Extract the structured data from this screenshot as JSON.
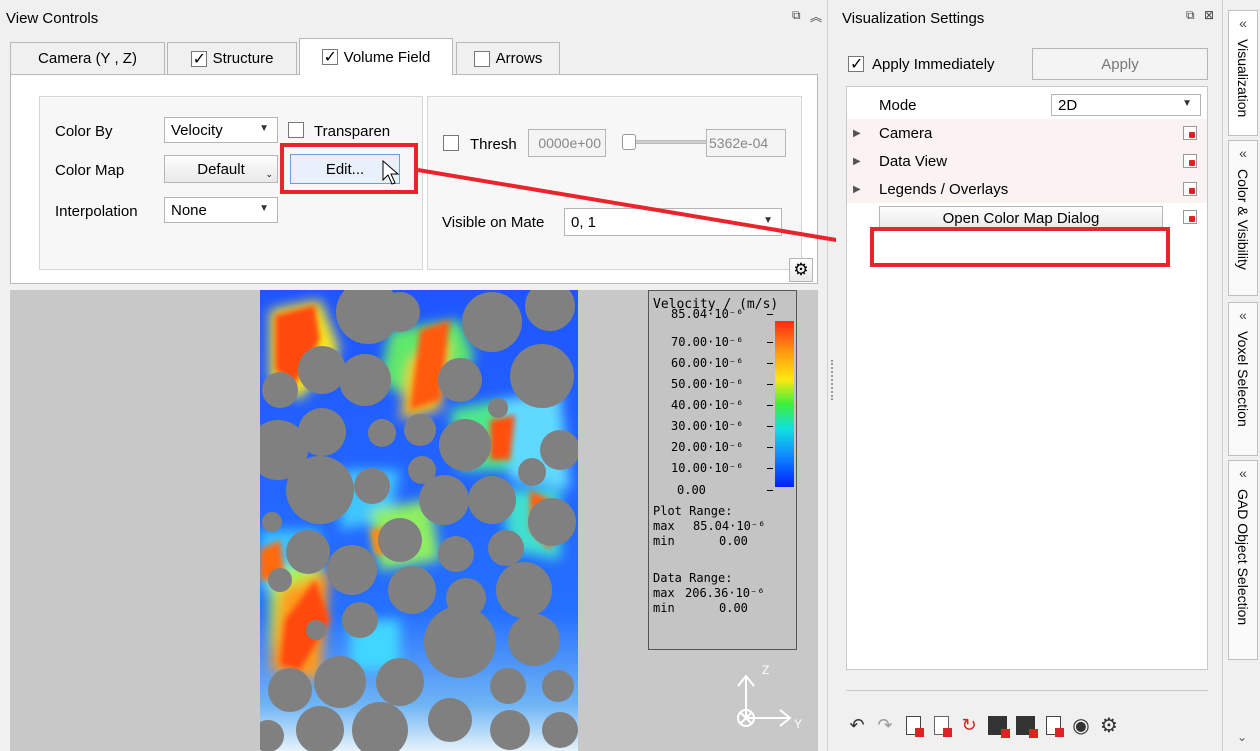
{
  "view_controls": {
    "title": "View Controls",
    "tabs": [
      {
        "label": "Camera (Y , Z)",
        "checkbox": null
      },
      {
        "label": "Structure",
        "checkbox": true
      },
      {
        "label": "Volume Field",
        "checkbox": true
      },
      {
        "label": "Arrows",
        "checkbox": false
      }
    ],
    "color_by": {
      "label": "Color By",
      "value": "Velocity"
    },
    "transparent": {
      "label": "Transparen",
      "checked": false
    },
    "color_map": {
      "label": "Color Map",
      "value": "Default",
      "edit_label": "Edit..."
    },
    "interpolation": {
      "label": "Interpolation",
      "value": "None"
    },
    "thresh": {
      "label": "Thresh",
      "checked": false,
      "min_value": "0000e+00",
      "max_value": "5362e-04"
    },
    "visible_on": {
      "label": "Visible on Mate",
      "value": "0, 1"
    }
  },
  "legend": {
    "title": "Velocity / (m/s)",
    "ticks": [
      "85.04·10⁻⁶",
      "70.00·10⁻⁶",
      "60.00·10⁻⁶",
      "50.00·10⁻⁶",
      "40.00·10⁻⁶",
      "30.00·10⁻⁶",
      "20.00·10⁻⁶",
      "10.00·10⁻⁶",
      "0.00"
    ],
    "plot_range": {
      "label": "Plot Range:",
      "max_label": "max",
      "max": "85.04·10⁻⁶",
      "min_label": "min",
      "min": "0.00"
    },
    "data_range": {
      "label": "Data Range:",
      "max_label": "max",
      "max": "206.36·10⁻⁶",
      "min_label": "min",
      "min": "0.00"
    }
  },
  "axes": {
    "z": "Z",
    "y": "Y"
  },
  "vis_settings": {
    "title": "Visualization Settings",
    "apply_immediately": {
      "label": "Apply Immediately",
      "checked": true
    },
    "apply_label": "Apply",
    "mode": {
      "label": "Mode",
      "value": "2D"
    },
    "categories": [
      "Camera",
      "Data View",
      "Legends / Overlays"
    ],
    "open_color_map_label": "Open Color Map Dialog"
  },
  "side_tabs": [
    "Visualization",
    "Color & Visibility",
    "Voxel Selection",
    "GAD Object Selection"
  ],
  "colors": {
    "highlight": "#e8242d"
  }
}
